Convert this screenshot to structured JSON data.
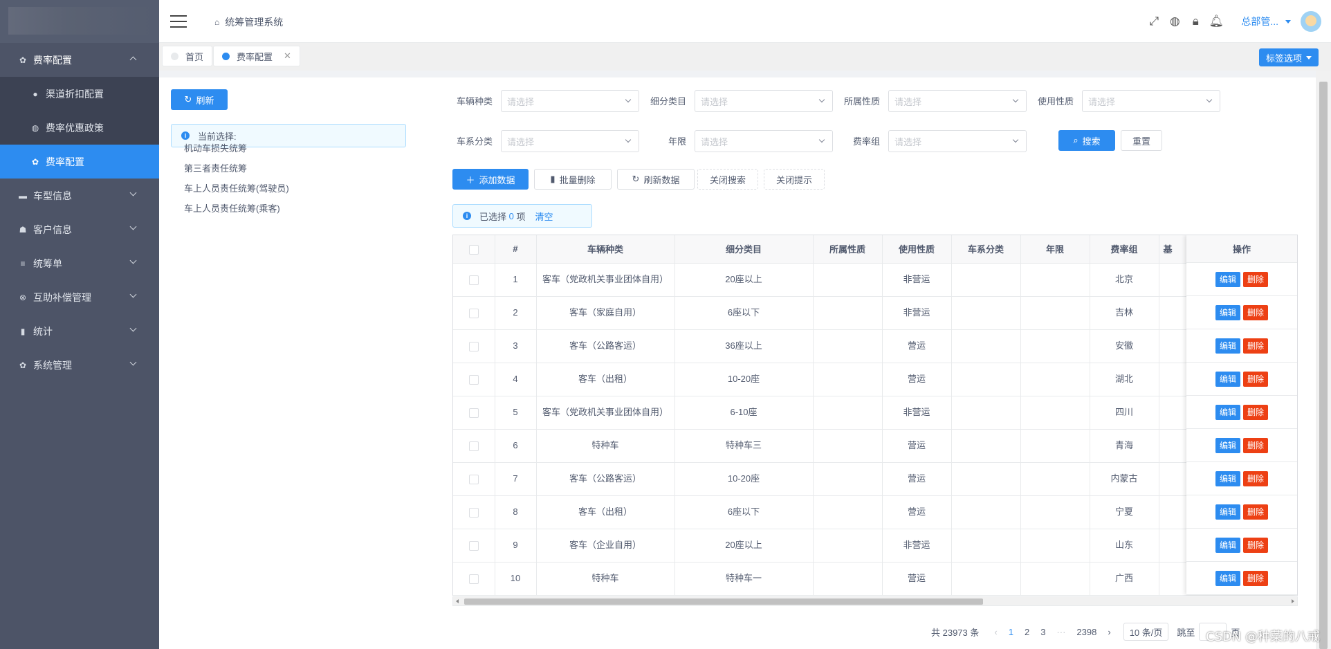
{
  "sidebar": {
    "items": [
      {
        "label": "费率配置",
        "icon": "gear-icon",
        "expanded": true
      },
      {
        "label": "车型信息",
        "icon": "car-icon"
      },
      {
        "label": "客户信息",
        "icon": "users-icon"
      },
      {
        "label": "统筹单",
        "icon": "list-icon"
      },
      {
        "label": "互助补偿管理",
        "icon": "compensation-icon"
      },
      {
        "label": "统计",
        "icon": "stats-icon"
      },
      {
        "label": "系统管理",
        "icon": "settings-icon"
      }
    ],
    "subitems": [
      {
        "label": "渠道折扣配置",
        "icon": "dot-icon"
      },
      {
        "label": "费率优惠政策",
        "icon": "globe-icon"
      },
      {
        "label": "费率配置",
        "icon": "gear-icon",
        "active": true
      }
    ]
  },
  "header": {
    "breadcrumb": "统筹管理系统",
    "user": "总部管..."
  },
  "tabs": [
    {
      "label": "首页",
      "active": false
    },
    {
      "label": "费率配置",
      "active": true
    }
  ],
  "tag_options": "标签选项",
  "left": {
    "refresh": "刷新",
    "current_selection": "当前选择:",
    "tree": [
      "机动车损失统筹",
      "第三者责任统筹",
      "车上人员责任统筹(驾驶员)",
      "车上人员责任统筹(乘客)"
    ]
  },
  "filters": {
    "labels": [
      "车辆种类",
      "细分类目",
      "所属性质",
      "使用性质",
      "车系分类",
      "年限",
      "费率组"
    ],
    "placeholder": "请选择",
    "search": "搜索",
    "reset": "重置"
  },
  "toolbar": {
    "add": "添加数据",
    "batch_delete": "批量删除",
    "refresh": "刷新数据",
    "close_search": "关闭搜索",
    "close_tip": "关闭提示"
  },
  "selection": {
    "prefix": "已选择",
    "count": "0",
    "suffix": "项",
    "clear": "清空"
  },
  "table": {
    "columns": [
      "#",
      "车辆种类",
      "细分类目",
      "所属性质",
      "使用性质",
      "车系分类",
      "年限",
      "费率组",
      "基"
    ],
    "action_col": "操作",
    "edit": "编辑",
    "delete": "删除",
    "rows": [
      [
        "1",
        "客车（党政机关事业团体自用）",
        "20座以上",
        "",
        "非营运",
        "",
        "",
        "北京"
      ],
      [
        "2",
        "客车（家庭自用）",
        "6座以下",
        "",
        "非营运",
        "",
        "",
        "吉林"
      ],
      [
        "3",
        "客车（公路客运）",
        "36座以上",
        "",
        "营运",
        "",
        "",
        "安徽"
      ],
      [
        "4",
        "客车（出租）",
        "10-20座",
        "",
        "营运",
        "",
        "",
        "湖北"
      ],
      [
        "5",
        "客车（党政机关事业团体自用）",
        "6-10座",
        "",
        "非营运",
        "",
        "",
        "四川"
      ],
      [
        "6",
        "特种车",
        "特种车三",
        "",
        "营运",
        "",
        "",
        "青海"
      ],
      [
        "7",
        "客车（公路客运）",
        "10-20座",
        "",
        "营运",
        "",
        "",
        "内蒙古"
      ],
      [
        "8",
        "客车（出租）",
        "6座以下",
        "",
        "营运",
        "",
        "",
        "宁夏"
      ],
      [
        "9",
        "客车（企业自用）",
        "20座以上",
        "",
        "非营运",
        "",
        "",
        "山东"
      ],
      [
        "10",
        "特种车",
        "特种车一",
        "",
        "营运",
        "",
        "",
        "广西"
      ]
    ]
  },
  "pagination": {
    "total": "共 23973 条",
    "pages": [
      "1",
      "2",
      "3",
      "···",
      "2398"
    ],
    "size": "10 条/页",
    "jump": "跳至",
    "page_unit": "页"
  },
  "watermark": "CSDN @种菜的八戒",
  "colors": {
    "primary": "#2d8cf0",
    "danger": "#ed4014",
    "sidebar": "#4d5467"
  }
}
